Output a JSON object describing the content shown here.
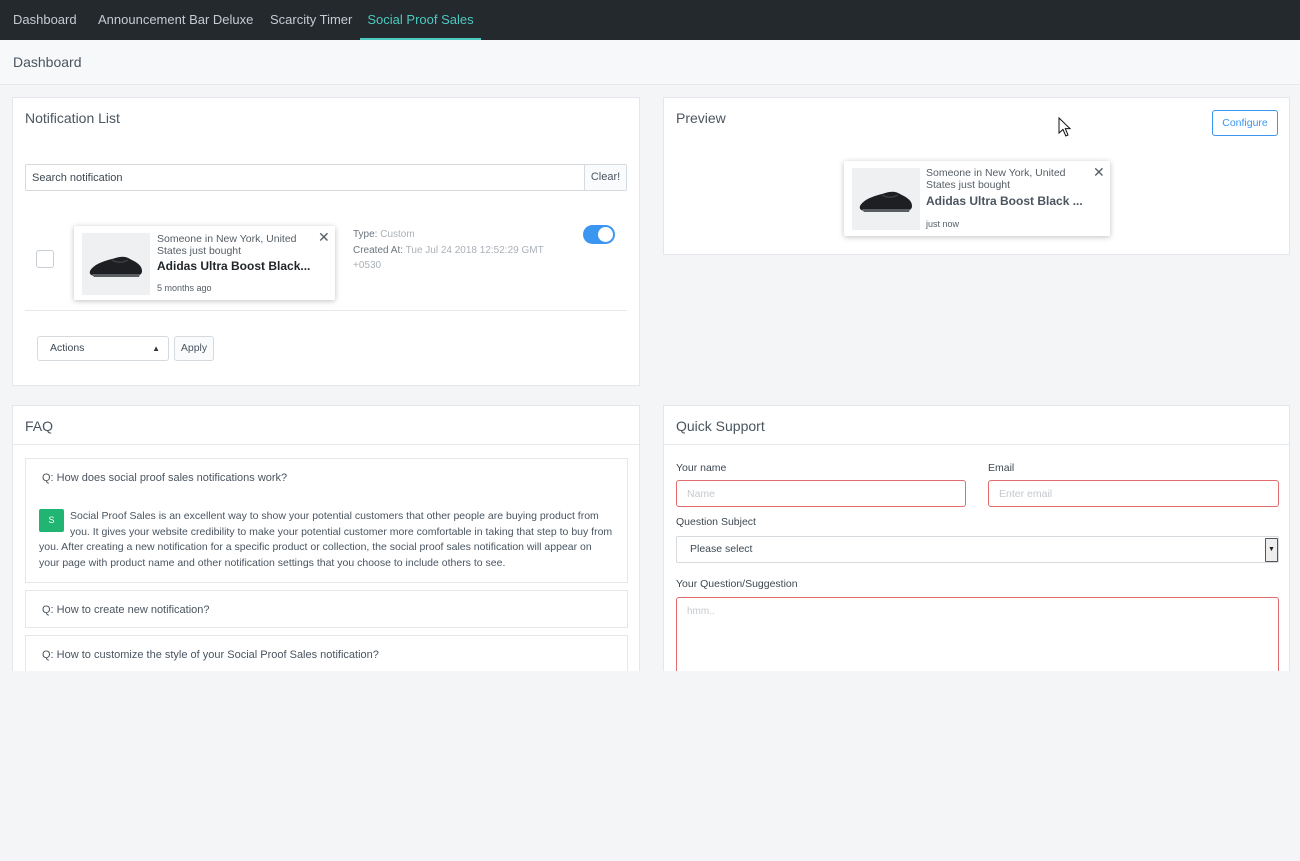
{
  "nav": {
    "tabs": [
      {
        "label": "Dashboard",
        "active": false
      },
      {
        "label": "Announcement Bar Deluxe",
        "active": false
      },
      {
        "label": "Scarcity Timer",
        "active": false
      },
      {
        "label": "Social Proof Sales",
        "active": true
      }
    ],
    "active_color": "#4cc9c0"
  },
  "breadcrumb": {
    "title": "Dashboard"
  },
  "notification_list": {
    "title": "Notification List",
    "search_placeholder": "Search notification",
    "clear_label": "Clear!",
    "items": [
      {
        "checked": false,
        "message": "Someone in New York, United States just bought",
        "product": "Adidas Ultra Boost Black...",
        "time_ago": "5 months ago",
        "type_label": "Type:",
        "type_value": "Custom",
        "created_label": "Created At:",
        "created_value": "Tue Jul 24 2018 12:52:29 GMT +0530",
        "enabled": true
      }
    ],
    "actions_label": "Actions",
    "apply_label": "Apply",
    "toggle_color": "#3b96f2"
  },
  "preview": {
    "title": "Preview",
    "configure_label": "Configure",
    "message": "Someone in New York, United States just bought",
    "product": "Adidas Ultra Boost Black ...",
    "time_ago": "just now"
  },
  "faq": {
    "title": "FAQ",
    "items": [
      {
        "question": "Q: How does social proof sales notifications work?",
        "badge": "S",
        "answer": "Social Proof Sales is an excellent way to show your potential customers that other people are buying product from you. It gives your website credibility to make your potential customer more comfortable in taking that step to buy from you. After creating a new notification for a specific product or collection, the social proof sales notification will appear on your page with product name and other notification settings that you choose to include others to see."
      },
      {
        "question": "Q: How to create new notification?"
      },
      {
        "question": "Q: How to customize the style of your Social Proof Sales notification?"
      }
    ],
    "badge_color": "#21b573"
  },
  "support": {
    "title": "Quick Support",
    "name_label": "Your name",
    "name_placeholder": "Name",
    "email_label": "Email",
    "email_placeholder": "Enter email",
    "subject_label": "Question Subject",
    "subject_value": "Please select",
    "question_label": "Your Question/Suggestion",
    "question_placeholder": "hmm..",
    "error_border_color": "#e46b6b"
  }
}
